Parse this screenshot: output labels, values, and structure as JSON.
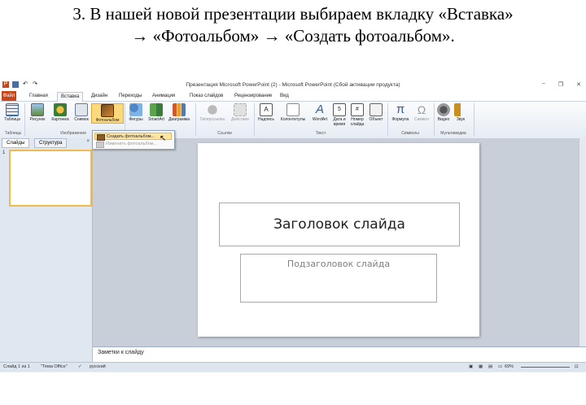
{
  "caption": {
    "line1": "3. В нашей новой презентации выбираем вкладку «Вставка»",
    "line2": "→ «Фотоальбом» → «Создать фотоальбом»."
  },
  "window": {
    "title": "Презентация Microsoft PowerPoint (2) - Microsoft PowerPoint (Сбой активации продукта)",
    "controls": [
      "−",
      "❐",
      "✕"
    ]
  },
  "tabs": [
    "Файл",
    "Главная",
    "Вставка",
    "Дизайн",
    "Переходы",
    "Анимация",
    "Показ слайдов",
    "Рецензирование",
    "Вид"
  ],
  "ribbon": {
    "buttons": {
      "table": "Таблица",
      "picture": "Рисунок",
      "clipart": "Картинка",
      "screenshot": "Снимок",
      "photoalbum": "Фотоальбом",
      "shapes": "Фигуры",
      "smartart": "SmartArt",
      "chart": "Диаграмма",
      "hyperlink": "Гиперссылка",
      "action": "Действие",
      "textbox": "Надпись",
      "headerfooter": "Колонтитулы",
      "wordart": "WordArt",
      "datetime": "Дата и время",
      "slidenum": "Номер слайда",
      "object": "Объект",
      "equation": "Формула",
      "symbol": "Символ",
      "video": "Видео",
      "audio": "Звук"
    },
    "groups": {
      "tables": "Таблицы",
      "images": "Изображения",
      "links": "Ссылки",
      "text": "Текст",
      "symbols": "Символы",
      "media": "Мультимедиа"
    }
  },
  "dropdown": {
    "create": "Создать фотоальбом...",
    "edit": "Изменить фотоальбом..."
  },
  "pane": {
    "tab_slides": "Слайды",
    "tab_outline": "Структура",
    "close": "×",
    "slide_number": "1"
  },
  "slide": {
    "title": "Заголовок слайда",
    "subtitle": "Подзаголовок слайда"
  },
  "notes": "Заметки к слайду",
  "status": {
    "slide": "Слайд 1 из 1",
    "theme": "\"Тема Office\"",
    "language": "русский",
    "zoom": "69%"
  }
}
